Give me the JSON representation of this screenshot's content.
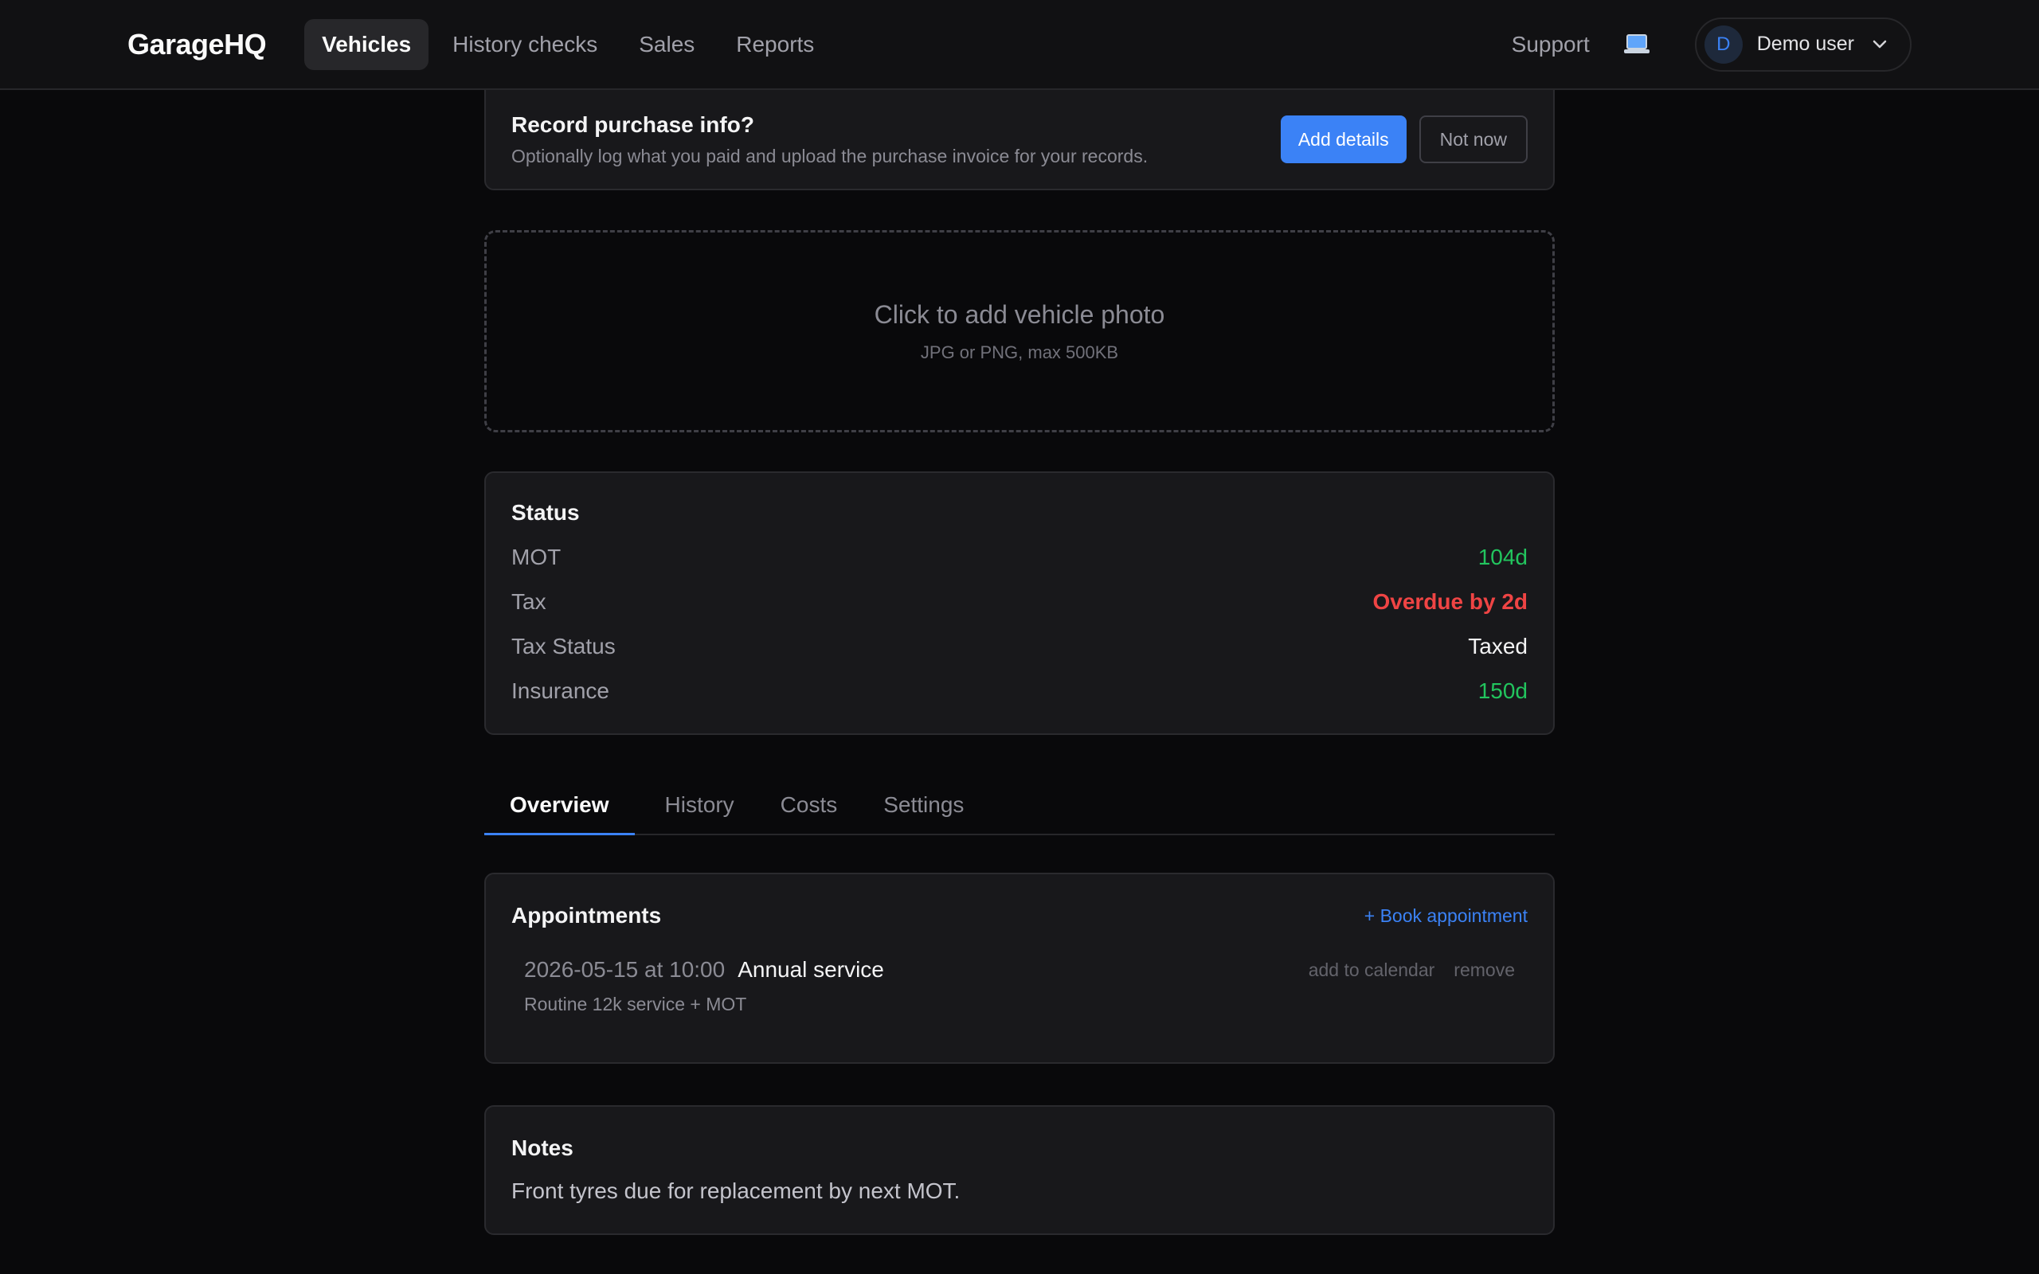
{
  "app": {
    "brand": "GarageHQ"
  },
  "nav": {
    "items": [
      {
        "label": "Vehicles",
        "active": true
      },
      {
        "label": "History checks",
        "active": false
      },
      {
        "label": "Sales",
        "active": false
      },
      {
        "label": "Reports",
        "active": false
      }
    ],
    "support_label": "Support",
    "device_icon": "laptop-icon",
    "user": {
      "initial": "D",
      "name": "Demo user"
    }
  },
  "purchase_banner": {
    "title": "Record purchase info?",
    "subtitle": "Optionally log what you paid and upload the purchase invoice for your records.",
    "primary_label": "Add details",
    "secondary_label": "Not now"
  },
  "photo_upload": {
    "title": "Click to add vehicle photo",
    "hint": "JPG or PNG, max 500KB"
  },
  "status": {
    "title": "Status",
    "rows": [
      {
        "label": "MOT",
        "value": "104d",
        "tone": "green"
      },
      {
        "label": "Tax",
        "value": "Overdue by 2d",
        "tone": "red"
      },
      {
        "label": "Tax Status",
        "value": "Taxed",
        "tone": "white"
      },
      {
        "label": "Insurance",
        "value": "150d",
        "tone": "green"
      }
    ]
  },
  "tabs": [
    {
      "label": "Overview",
      "active": true
    },
    {
      "label": "History",
      "active": false
    },
    {
      "label": "Costs",
      "active": false
    },
    {
      "label": "Settings",
      "active": false
    }
  ],
  "appointments": {
    "title": "Appointments",
    "book_label": "+ Book appointment",
    "items": [
      {
        "when": "2026-05-15 at 10:00",
        "title": "Annual service",
        "description": "Routine 12k service + MOT",
        "add_calendar_label": "add to calendar",
        "remove_label": "remove"
      }
    ]
  },
  "notes": {
    "title": "Notes",
    "text": "Front tyres due for replacement by next MOT."
  },
  "colors": {
    "accent": "#3b82f6",
    "ok": "#22c55e",
    "danger": "#ef4444",
    "background": "#09090b",
    "card": "#18181b"
  }
}
